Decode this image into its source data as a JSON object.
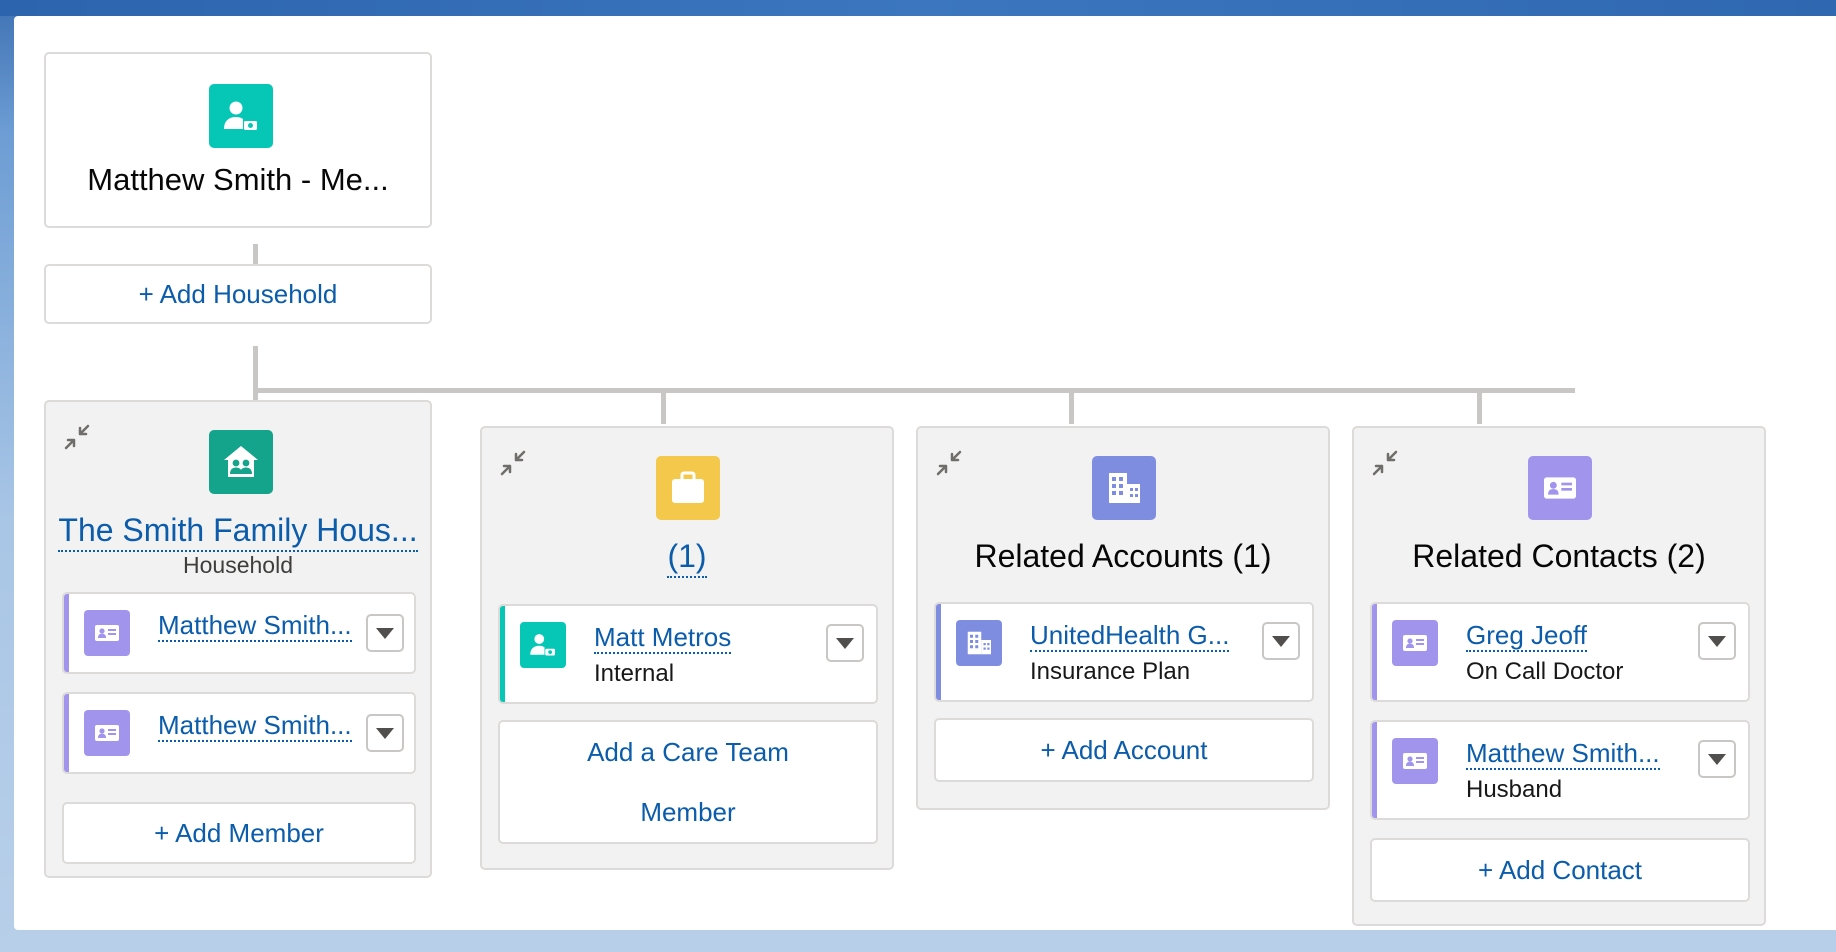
{
  "colors": {
    "member_icon": "#06c7b6",
    "household_icon": "#14a38b",
    "care_team_icon": "#f4c84a",
    "account_icon": "#7f8de1",
    "contact_icon": "#a094ed",
    "link": "#0b5cab",
    "connector": "#c9c7c5"
  },
  "root": {
    "icon": "member-account-icon",
    "title": "Matthew Smith - Me...",
    "add_household_label": "+ Add Household"
  },
  "groups": {
    "household": {
      "icon": "household-icon",
      "title": "The Smith Family Hous...",
      "subtitle": "Household",
      "members": [
        {
          "icon": "contact-card-icon",
          "name": "Matthew Smith..."
        },
        {
          "icon": "contact-card-icon",
          "name": "Matthew Smith..."
        }
      ],
      "add_label": "+ Add Member"
    },
    "care_team": {
      "icon": "briefcase-icon",
      "title": "(1)",
      "members": [
        {
          "icon": "member-account-icon",
          "name": "Matt Metros",
          "role": "Internal"
        }
      ],
      "add_label_line1": "Add a Care Team",
      "add_label_line2": "Member"
    },
    "accounts": {
      "icon": "building-icon",
      "title": "Related Accounts (1)",
      "items": [
        {
          "icon": "building-icon",
          "name": "UnitedHealth G...",
          "role": "Insurance Plan"
        }
      ],
      "add_label": "+ Add Account"
    },
    "contacts": {
      "icon": "contact-card-icon",
      "title": "Related Contacts (2)",
      "items": [
        {
          "icon": "contact-card-icon",
          "name": "Greg Jeoff",
          "role": "On Call Doctor"
        },
        {
          "icon": "contact-card-icon",
          "name": "Matthew Smith...",
          "role": "Husband"
        }
      ],
      "add_label": "+ Add Contact"
    }
  }
}
